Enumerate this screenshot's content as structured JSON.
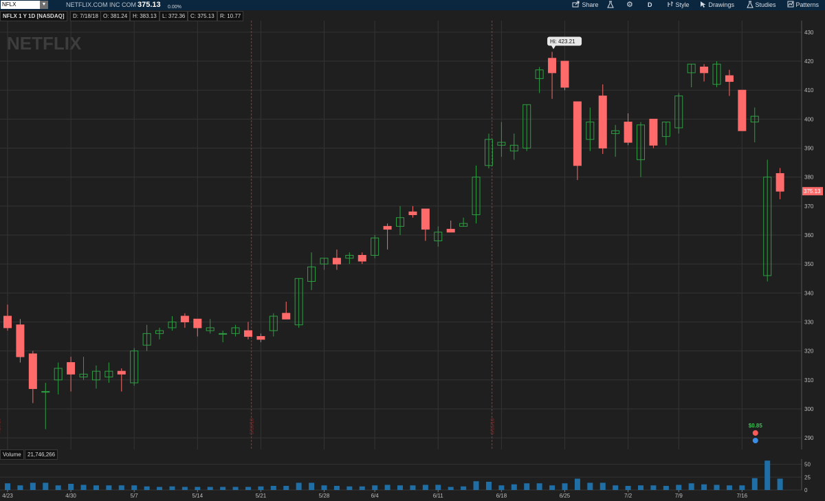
{
  "symbol": {
    "ticker": "NFLX",
    "dropdown_glyph": "▼"
  },
  "company": "NETFLIX.COM INC COM",
  "price": "375.13",
  "change": "0.00%",
  "toolbar": {
    "share": "Share",
    "period": "D",
    "style": "Style",
    "drawings": "Drawings",
    "studies": "Studies",
    "patterns": "Patterns"
  },
  "info": {
    "title": "NFLX 1 Y 1D [NASDAQ]",
    "date": "D: 7/18/18",
    "open": "O: 381.24",
    "high": "H: 383.13",
    "low": "L: 372.36",
    "close": "C: 375.13",
    "range": "R: 10.77"
  },
  "watermark": "NETFLIX",
  "colors": {
    "up": "#2ea043",
    "down": "#ff6b6b",
    "bg": "#1f1f1f",
    "grid": "#343434",
    "divider": "#b52a2a",
    "volume": "#1f6fa6",
    "topbar": "#0b2740"
  },
  "chart_data": {
    "type": "candlestick",
    "ticker": "NFLX",
    "interval": "1D",
    "ylim": [
      286,
      434
    ],
    "yticks": [
      290,
      300,
      310,
      320,
      330,
      340,
      350,
      360,
      370,
      380,
      390,
      400,
      410,
      420,
      430
    ],
    "date_ticks": [
      {
        "label": "4/23",
        "index": 0
      },
      {
        "label": "4/30",
        "index": 5
      },
      {
        "label": "5/7",
        "index": 10
      },
      {
        "label": "5/14",
        "index": 15
      },
      {
        "label": "5/21",
        "index": 20
      },
      {
        "label": "5/28",
        "index": 25
      },
      {
        "label": "6/4",
        "index": 29
      },
      {
        "label": "6/11",
        "index": 34
      },
      {
        "label": "6/18",
        "index": 39
      },
      {
        "label": "6/25",
        "index": 44
      },
      {
        "label": "7/2",
        "index": 49
      },
      {
        "label": "7/9",
        "index": 53
      },
      {
        "label": "7/16",
        "index": 58
      }
    ],
    "month_dividers": [
      {
        "label": "4/20/18",
        "index": -0.8
      },
      {
        "label": "5/18/18",
        "index": 19.2
      },
      {
        "label": "6/15/18",
        "index": 38.2
      }
    ],
    "high_annotation": {
      "label": "Hi: 423.21",
      "index": 43
    },
    "last_price_label": "375.13",
    "dividend": {
      "label": "$0.85",
      "index": 59
    },
    "candles": [
      {
        "o": 332,
        "h": 336,
        "l": 327,
        "c": 328
      },
      {
        "o": 329,
        "h": 331,
        "l": 316,
        "c": 318
      },
      {
        "o": 319,
        "h": 320,
        "l": 302,
        "c": 307
      },
      {
        "o": 306,
        "h": 309,
        "l": 293,
        "c": 306
      },
      {
        "o": 310,
        "h": 316,
        "l": 305,
        "c": 314
      },
      {
        "o": 316,
        "h": 318,
        "l": 306,
        "c": 312
      },
      {
        "o": 311,
        "h": 318,
        "l": 310,
        "c": 312
      },
      {
        "o": 310,
        "h": 315,
        "l": 307,
        "c": 313
      },
      {
        "o": 311,
        "h": 316,
        "l": 309,
        "c": 313
      },
      {
        "o": 313,
        "h": 314,
        "l": 306,
        "c": 312
      },
      {
        "o": 309,
        "h": 321,
        "l": 308,
        "c": 320
      },
      {
        "o": 322,
        "h": 329,
        "l": 320,
        "c": 326
      },
      {
        "o": 326,
        "h": 328,
        "l": 324,
        "c": 327
      },
      {
        "o": 328,
        "h": 332,
        "l": 327,
        "c": 330
      },
      {
        "o": 332,
        "h": 333,
        "l": 328,
        "c": 330
      },
      {
        "o": 331,
        "h": 331,
        "l": 325,
        "c": 328
      },
      {
        "o": 327,
        "h": 331,
        "l": 326,
        "c": 328
      },
      {
        "o": 326,
        "h": 327,
        "l": 323,
        "c": 326
      },
      {
        "o": 326,
        "h": 329,
        "l": 325,
        "c": 328
      },
      {
        "o": 327,
        "h": 330,
        "l": 324,
        "c": 325
      },
      {
        "o": 325,
        "h": 326,
        "l": 323,
        "c": 324
      },
      {
        "o": 327,
        "h": 333,
        "l": 325,
        "c": 332
      },
      {
        "o": 333,
        "h": 337,
        "l": 331,
        "c": 331
      },
      {
        "o": 329,
        "h": 345,
        "l": 328,
        "c": 345
      },
      {
        "o": 344,
        "h": 354,
        "l": 341,
        "c": 349
      },
      {
        "o": 350,
        "h": 352,
        "l": 348,
        "c": 352
      },
      {
        "o": 352,
        "h": 355,
        "l": 348,
        "c": 350
      },
      {
        "o": 352,
        "h": 354,
        "l": 350,
        "c": 353
      },
      {
        "o": 353,
        "h": 354,
        "l": 350,
        "c": 351
      },
      {
        "o": 353,
        "h": 360,
        "l": 352,
        "c": 359
      },
      {
        "o": 363,
        "h": 364,
        "l": 355,
        "c": 362
      },
      {
        "o": 363,
        "h": 370,
        "l": 360,
        "c": 366
      },
      {
        "o": 368,
        "h": 370,
        "l": 366,
        "c": 367
      },
      {
        "o": 369,
        "h": 369,
        "l": 358,
        "c": 362
      },
      {
        "o": 358,
        "h": 363,
        "l": 356,
        "c": 361
      },
      {
        "o": 362,
        "h": 365,
        "l": 361,
        "c": 361
      },
      {
        "o": 363,
        "h": 366,
        "l": 363,
        "c": 364
      },
      {
        "o": 367,
        "h": 384,
        "l": 364,
        "c": 380
      },
      {
        "o": 384,
        "h": 395,
        "l": 383,
        "c": 393
      },
      {
        "o": 391,
        "h": 399,
        "l": 387,
        "c": 392
      },
      {
        "o": 389,
        "h": 395,
        "l": 386,
        "c": 391
      },
      {
        "o": 390,
        "h": 405,
        "l": 389,
        "c": 405
      },
      {
        "o": 414,
        "h": 418,
        "l": 409,
        "c": 417
      },
      {
        "o": 421,
        "h": 423.21,
        "l": 407,
        "c": 416
      },
      {
        "o": 420,
        "h": 420,
        "l": 410,
        "c": 411
      },
      {
        "o": 406,
        "h": 406,
        "l": 379,
        "c": 384
      },
      {
        "o": 393,
        "h": 404,
        "l": 389,
        "c": 399
      },
      {
        "o": 408,
        "h": 412,
        "l": 388,
        "c": 390
      },
      {
        "o": 395,
        "h": 398,
        "l": 387,
        "c": 396
      },
      {
        "o": 399,
        "h": 402,
        "l": 391,
        "c": 392
      },
      {
        "o": 386,
        "h": 399,
        "l": 380,
        "c": 398
      },
      {
        "o": 400,
        "h": 400,
        "l": 390,
        "c": 391
      },
      {
        "o": 394,
        "h": 399,
        "l": 391,
        "c": 399
      },
      {
        "o": 397,
        "h": 409,
        "l": 395,
        "c": 408
      },
      {
        "o": 416,
        "h": 419,
        "l": 411,
        "c": 419
      },
      {
        "o": 418,
        "h": 419,
        "l": 413,
        "c": 416
      },
      {
        "o": 412,
        "h": 420,
        "l": 411,
        "c": 419
      },
      {
        "o": 415,
        "h": 417,
        "l": 408,
        "c": 413
      },
      {
        "o": 410,
        "h": 410,
        "l": 396,
        "c": 396
      },
      {
        "o": 399,
        "h": 404,
        "l": 392,
        "c": 401
      },
      {
        "o": 346,
        "h": 386,
        "l": 344,
        "c": 380
      },
      {
        "o": 381.24,
        "h": 383.13,
        "l": 372.36,
        "c": 375.13
      }
    ],
    "volume": {
      "label": "Volume",
      "last_value": "21,746,266",
      "ylim": [
        0,
        60
      ],
      "yticks": [
        0,
        25,
        50
      ],
      "values": [
        13,
        9,
        14,
        14,
        9,
        12,
        10,
        9,
        9,
        9,
        9,
        7,
        6,
        7,
        6,
        6,
        6,
        6,
        6,
        6,
        7,
        8,
        8,
        14,
        14,
        9,
        8,
        7,
        7,
        9,
        10,
        9,
        9,
        10,
        10,
        6,
        7,
        17,
        16,
        9,
        11,
        13,
        13,
        9,
        13,
        22,
        14,
        14,
        9,
        8,
        9,
        9,
        8,
        10,
        13,
        11,
        10,
        9,
        9,
        23,
        57,
        22
      ]
    }
  }
}
